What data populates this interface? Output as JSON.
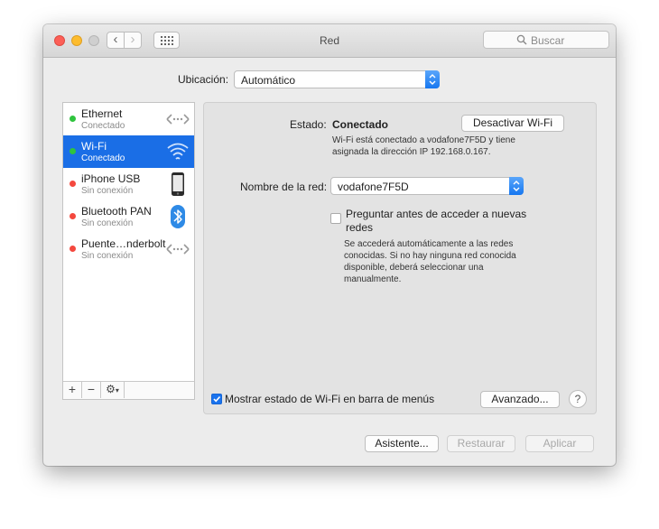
{
  "window": {
    "title": "Red"
  },
  "search": {
    "placeholder": "Buscar"
  },
  "location": {
    "label": "Ubicación:",
    "value": "Automático"
  },
  "services": [
    {
      "name": "Ethernet",
      "status": "Conectado",
      "state_color": "#2fc43e",
      "icon": "ethernet-icon",
      "selected": false
    },
    {
      "name": "Wi-Fi",
      "status": "Conectado",
      "state_color": "#2fc43e",
      "icon": "wifi-icon",
      "selected": true
    },
    {
      "name": "iPhone USB",
      "status": "Sin conexión",
      "state_color": "#f4483e",
      "icon": "iphone-icon",
      "selected": false
    },
    {
      "name": "Bluetooth PAN",
      "status": "Sin conexión",
      "state_color": "#f4483e",
      "icon": "bluetooth-icon",
      "selected": false
    },
    {
      "name": "Puente…nderbolt",
      "status": "Sin conexión",
      "state_color": "#f4483e",
      "icon": "thunderbolt-bridge-icon",
      "selected": false
    }
  ],
  "sidebar_footer": {
    "add": "+",
    "remove": "−",
    "action": "⚙"
  },
  "detail": {
    "status_label": "Estado:",
    "status_value": "Conectado",
    "toggle_button": "Desactivar Wi-Fi",
    "status_description_line1": "Wi-Fi está conectado a vodafone7F5D y tiene",
    "status_description_line2": "asignada la dirección IP 192.168.0.167.",
    "network_label": "Nombre de la red:",
    "network_value": "vodafone7F5D",
    "ask_checkbox_line1": "Preguntar antes de acceder a nuevas",
    "ask_checkbox_line2": "redes",
    "ask_checked": false,
    "ask_help_line1": "Se accederá automáticamente a las redes",
    "ask_help_line2": "conocidas. Si no hay ninguna red conocida",
    "ask_help_line3": "disponible, deberá seleccionar una",
    "ask_help_line4": "manualmente.",
    "show_menu_checkbox": "Mostrar estado de Wi-Fi en barra de menús",
    "show_menu_checked": true,
    "advanced_button": "Avanzado...",
    "help_button": "?"
  },
  "footer": {
    "assistant_button": "Asistente...",
    "revert_button": "Restaurar",
    "apply_button": "Aplicar"
  }
}
